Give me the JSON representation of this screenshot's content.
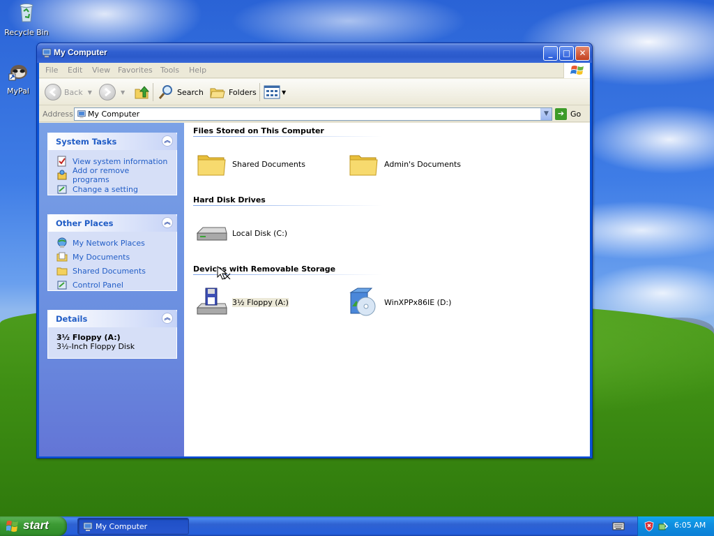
{
  "desktop": {
    "icons": [
      {
        "label": "Recycle Bin",
        "icon": "recycle-bin-icon"
      },
      {
        "label": "MyPal",
        "icon": "mypal-icon"
      }
    ]
  },
  "window": {
    "title": "My Computer",
    "controls": {
      "minimize": "_",
      "maximize": "□",
      "close": "✕"
    }
  },
  "menu": {
    "items": [
      "File",
      "Edit",
      "View",
      "Favorites",
      "Tools",
      "Help"
    ]
  },
  "toolbar": {
    "back_label": "Back",
    "forward_label": "",
    "search_label": "Search",
    "folders_label": "Folders"
  },
  "address": {
    "label": "Address",
    "value": "My Computer",
    "go_label": "Go"
  },
  "taskpane": {
    "system_tasks": {
      "title": "System Tasks",
      "items": [
        "View system information",
        "Add or remove programs",
        "Change a setting"
      ]
    },
    "other_places": {
      "title": "Other Places",
      "items": [
        "My Network Places",
        "My Documents",
        "Shared Documents",
        "Control Panel"
      ]
    },
    "details": {
      "title": "Details",
      "name": "3½ Floppy (A:)",
      "type": "3½-Inch Floppy Disk"
    }
  },
  "content": {
    "groups": [
      {
        "title": "Files Stored on This Computer",
        "items": [
          {
            "label": "Shared Documents",
            "icon": "folder-icon"
          },
          {
            "label": "Admin's Documents",
            "icon": "folder-icon"
          }
        ]
      },
      {
        "title": "Hard Disk Drives",
        "items": [
          {
            "label": "Local Disk (C:)",
            "icon": "hard-disk-icon"
          }
        ]
      },
      {
        "title": "Devices with Removable Storage",
        "items": [
          {
            "label": "3½ Floppy (A:)",
            "icon": "floppy-drive-icon",
            "selected": true
          },
          {
            "label": "WinXPPx86IE (D:)",
            "icon": "cd-drive-icon"
          }
        ]
      }
    ]
  },
  "taskbar": {
    "start_label": "start",
    "task_label": "My Computer",
    "clock": "6:05 AM"
  },
  "colors": {
    "titlebar": "#2b5acb",
    "taskpane_link": "#215dc6",
    "start_green": "#3c9a34",
    "tray": "#0f8fe0"
  }
}
